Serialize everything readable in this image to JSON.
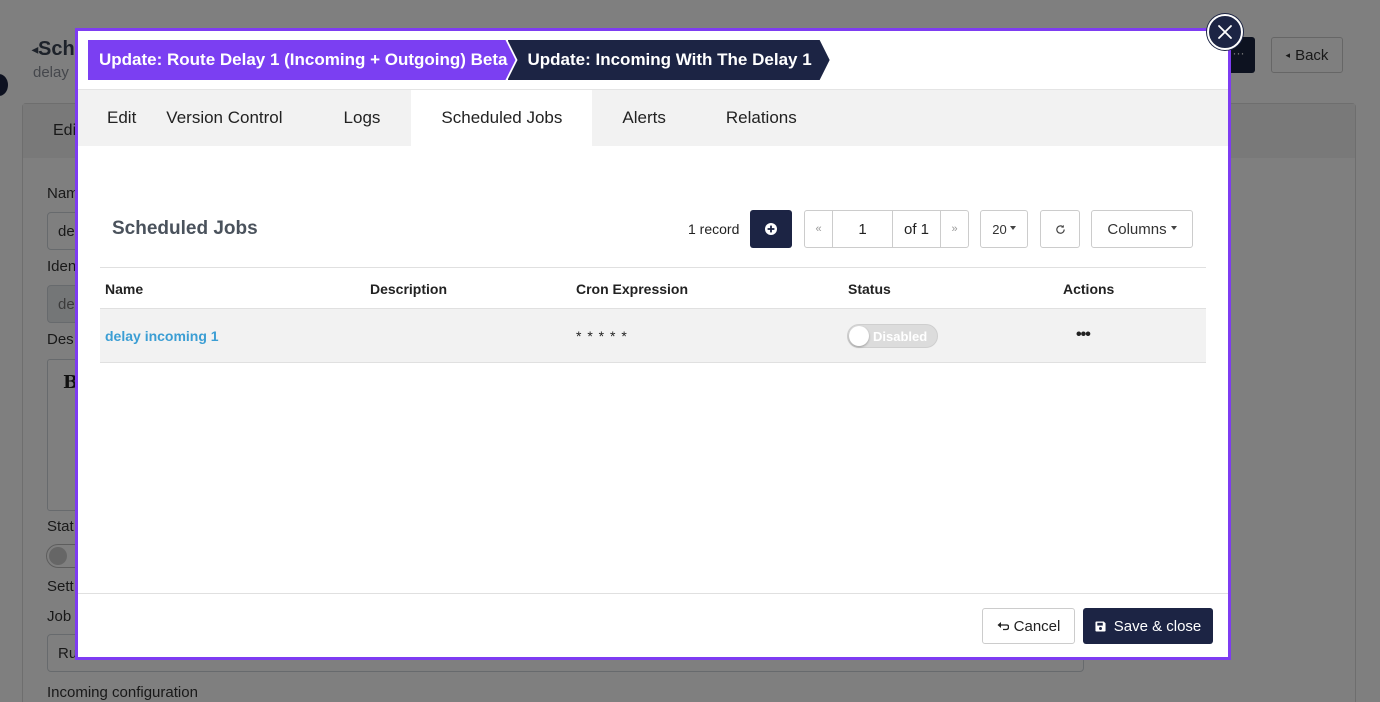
{
  "background": {
    "title": "Sch",
    "subtitle": "delay",
    "tab_edit": "Edi",
    "label_name": "Nam",
    "name_value": "de",
    "label_identifier": "Iden",
    "identifier_value": "de",
    "label_description": "Des",
    "editor_bold": "B",
    "label_status": "Stat",
    "label_settings": "Sett",
    "label_job": "Job",
    "job_value": "Ru",
    "label_incoming": "Incoming configuration",
    "more_label": "···",
    "back_label": "Back"
  },
  "modal": {
    "breadcrumbs": [
      "Update: Route Delay 1 (Incoming + Outgoing) Beta",
      "Update: Incoming With The Delay 1"
    ],
    "tabs": [
      {
        "label": "Edit"
      },
      {
        "label": "Version Control"
      },
      {
        "label": "Logs"
      },
      {
        "label": "Scheduled Jobs",
        "active": true
      },
      {
        "label": "Alerts"
      },
      {
        "label": "Relations"
      }
    ],
    "section_title": "Scheduled Jobs",
    "toolbar": {
      "record_count": "1 record",
      "first_page": "«",
      "page": "1",
      "of_pages": "of 1",
      "last_page": "»",
      "page_size": "20",
      "columns_label": "Columns"
    },
    "table": {
      "columns": [
        "Name",
        "Description",
        "Cron Expression",
        "Status",
        "Actions"
      ],
      "rows": [
        {
          "name": "delay incoming 1",
          "description": "",
          "cron": "* * * * *",
          "status": "Disabled",
          "actions": "•••"
        }
      ]
    },
    "footer": {
      "cancel_label": "Cancel",
      "save_label": "Save & close"
    }
  },
  "colors": {
    "accent_purple": "#7b3ff2",
    "navy": "#1c2444",
    "link_blue": "#3b9ed4"
  }
}
